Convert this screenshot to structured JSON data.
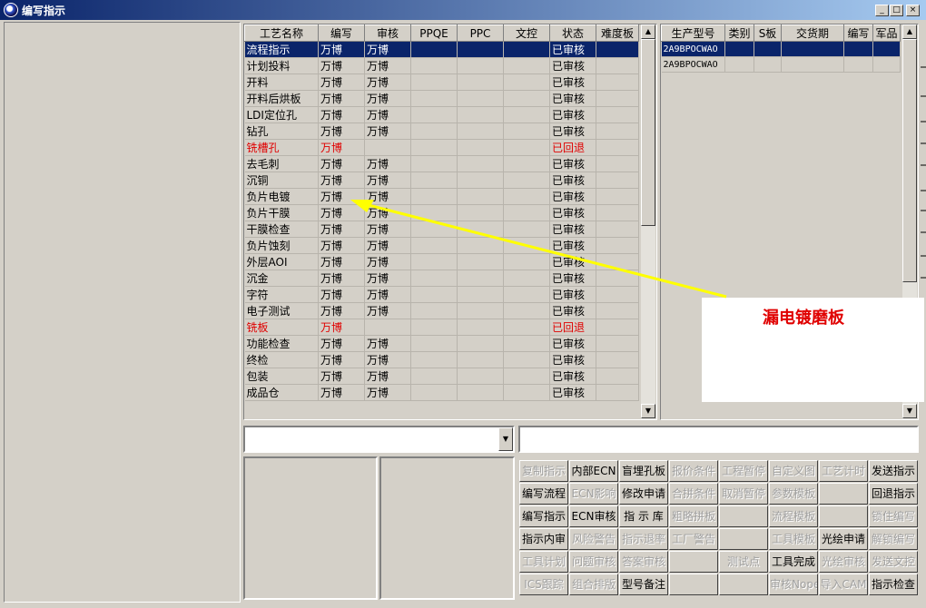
{
  "window": {
    "title": "编写指示",
    "controls": [
      "_",
      "□",
      "×"
    ]
  },
  "process_table": {
    "columns": [
      "工艺名称",
      "编写",
      "审核",
      "PPQE",
      "PPC",
      "文控",
      "状态",
      "难度板"
    ],
    "rows": [
      {
        "name": "流程指示",
        "writer": "万博",
        "reviewer": "万博",
        "status": "已审核",
        "selected": true
      },
      {
        "name": "计划投料",
        "writer": "万博",
        "reviewer": "万博",
        "status": "已审核"
      },
      {
        "name": "开料",
        "writer": "万博",
        "reviewer": "万博",
        "status": "已审核"
      },
      {
        "name": "开料后烘板",
        "writer": "万博",
        "reviewer": "万博",
        "status": "已审核"
      },
      {
        "name": "LDI定位孔",
        "writer": "万博",
        "reviewer": "万博",
        "status": "已审核"
      },
      {
        "name": "钻孔",
        "writer": "万博",
        "reviewer": "万博",
        "status": "已审核"
      },
      {
        "name": "铣槽孔",
        "writer": "万博",
        "reviewer": "",
        "status": "已回退",
        "returned": true
      },
      {
        "name": "去毛刺",
        "writer": "万博",
        "reviewer": "万博",
        "status": "已审核"
      },
      {
        "name": "沉铜",
        "writer": "万博",
        "reviewer": "万博",
        "status": "已审核"
      },
      {
        "name": "负片电镀",
        "writer": "万博",
        "reviewer": "万博",
        "status": "已审核"
      },
      {
        "name": "负片干膜",
        "writer": "万博",
        "reviewer": "万博",
        "status": "已审核"
      },
      {
        "name": "干膜检查",
        "writer": "万博",
        "reviewer": "万博",
        "status": "已审核"
      },
      {
        "name": "负片蚀刻",
        "writer": "万博",
        "reviewer": "万博",
        "status": "已审核"
      },
      {
        "name": "外层AOI",
        "writer": "万博",
        "reviewer": "万博",
        "status": "已审核"
      },
      {
        "name": "沉金",
        "writer": "万博",
        "reviewer": "万博",
        "status": "已审核"
      },
      {
        "name": "字符",
        "writer": "万博",
        "reviewer": "万博",
        "status": "已审核"
      },
      {
        "name": "电子测试",
        "writer": "万博",
        "reviewer": "万博",
        "status": "已审核"
      },
      {
        "name": "铣板",
        "writer": "万博",
        "reviewer": "",
        "status": "已回退",
        "returned": true
      },
      {
        "name": "功能检查",
        "writer": "万博",
        "reviewer": "万博",
        "status": "已审核"
      },
      {
        "name": "终检",
        "writer": "万博",
        "reviewer": "万博",
        "status": "已审核"
      },
      {
        "name": "包装",
        "writer": "万博",
        "reviewer": "万博",
        "status": "已审核"
      },
      {
        "name": "成品仓",
        "writer": "万博",
        "reviewer": "万博",
        "status": "已审核"
      }
    ]
  },
  "model_table": {
    "columns": [
      "生产型号",
      "类别",
      "S板",
      "交货期",
      "编写",
      "军品"
    ],
    "rows": [
      {
        "model": "2A9BPOCWAO",
        "selected": true
      },
      {
        "model": "2A9BPOCWAO"
      }
    ]
  },
  "combo_left": {
    "value": ""
  },
  "combo_right": {
    "value": ""
  },
  "buttons": [
    [
      {
        "label": "复制指示",
        "enabled": false
      },
      {
        "label": "内部ECN",
        "enabled": true
      },
      {
        "label": "盲埋孔板",
        "enabled": true
      },
      {
        "label": "报价条件",
        "enabled": false
      },
      {
        "label": "工程暂停",
        "enabled": false
      },
      {
        "label": "自定义图",
        "enabled": false
      },
      {
        "label": "工艺计时",
        "enabled": false
      },
      {
        "label": "发送指示",
        "enabled": true
      }
    ],
    [
      {
        "label": "编写流程",
        "enabled": true
      },
      {
        "label": "ECN影响",
        "enabled": false
      },
      {
        "label": "修改申请",
        "enabled": true
      },
      {
        "label": "合拼条件",
        "enabled": false
      },
      {
        "label": "取消暂停",
        "enabled": false
      },
      {
        "label": "参数模板",
        "enabled": false
      },
      {
        "label": "",
        "enabled": false
      },
      {
        "label": "回退指示",
        "enabled": true
      }
    ],
    [
      {
        "label": "编写指示",
        "enabled": true
      },
      {
        "label": "ECN审核",
        "enabled": true
      },
      {
        "label": "指 示 库",
        "enabled": true
      },
      {
        "label": "粗略拼板",
        "enabled": false
      },
      {
        "label": "",
        "enabled": false
      },
      {
        "label": "流程模板",
        "enabled": false
      },
      {
        "label": "",
        "enabled": false
      },
      {
        "label": "锁住编写",
        "enabled": false
      }
    ],
    [
      {
        "label": "指示内审",
        "enabled": true
      },
      {
        "label": "风险警告",
        "enabled": false
      },
      {
        "label": "指示退率",
        "enabled": false
      },
      {
        "label": "工厂警告",
        "enabled": false
      },
      {
        "label": "",
        "enabled": false
      },
      {
        "label": "工具模板",
        "enabled": false
      },
      {
        "label": "光绘申请",
        "enabled": true
      },
      {
        "label": "解锁编写",
        "enabled": false
      }
    ],
    [
      {
        "label": "工具计划",
        "enabled": false
      },
      {
        "label": "问题审核",
        "enabled": false
      },
      {
        "label": "答案审核",
        "enabled": false
      },
      {
        "label": "",
        "enabled": false
      },
      {
        "label": "测试点",
        "enabled": false
      },
      {
        "label": "工具完成",
        "enabled": true
      },
      {
        "label": "光绘审核",
        "enabled": false
      },
      {
        "label": "发送文控",
        "enabled": false
      }
    ],
    [
      {
        "label": "ICS跟踪",
        "enabled": false
      },
      {
        "label": "组合排版",
        "enabled": false
      },
      {
        "label": "型号备注",
        "enabled": true
      },
      {
        "label": "",
        "enabled": false
      },
      {
        "label": "",
        "enabled": false
      },
      {
        "label": "审核Nope",
        "enabled": false
      },
      {
        "label": "导入CAM",
        "enabled": false
      },
      {
        "label": "指示检查",
        "enabled": true
      }
    ]
  ],
  "annotation": {
    "text": "漏电镀磨板",
    "color": "#e00000",
    "arrow_color": "#ffff00"
  },
  "colors": {
    "selection": "#0a246a",
    "returned_text": "#e00000",
    "face": "#d4d0c8"
  }
}
